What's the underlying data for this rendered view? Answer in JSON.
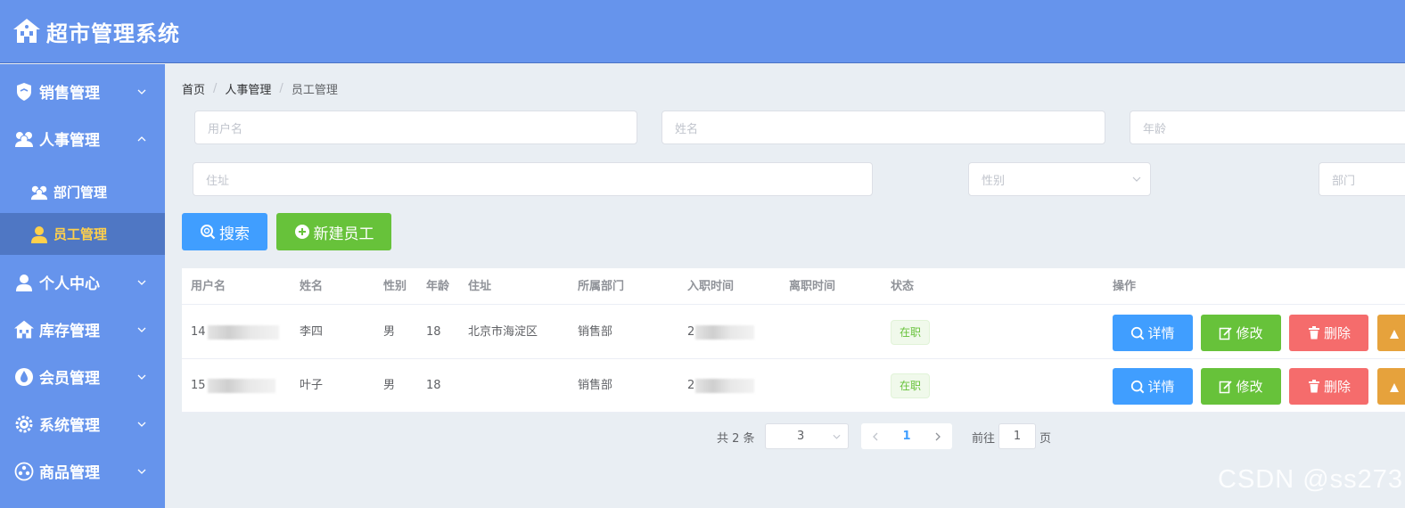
{
  "header": {
    "title": "超市管理系统"
  },
  "sidebar": {
    "items": [
      {
        "label": "销售管理"
      },
      {
        "label": "人事管理"
      },
      {
        "label": "部门管理"
      },
      {
        "label": "员工管理"
      },
      {
        "label": "个人中心"
      },
      {
        "label": "库存管理"
      },
      {
        "label": "会员管理"
      },
      {
        "label": "系统管理"
      },
      {
        "label": "商品管理"
      }
    ]
  },
  "breadcrumb": {
    "items": [
      "首页",
      "人事管理",
      "员工管理"
    ],
    "separator": "/"
  },
  "filters": {
    "username_placeholder": "用户名",
    "name_placeholder": "姓名",
    "age_placeholder": "年龄",
    "address_placeholder": "住址",
    "gender_placeholder": "性别",
    "department_placeholder": "部门"
  },
  "actions": {
    "search_label": "搜索",
    "new_label": "新建员工"
  },
  "table": {
    "columns": [
      "用户名",
      "姓名",
      "性别",
      "年龄",
      "住址",
      "所属部门",
      "入职时间",
      "离职时间",
      "状态",
      "操作"
    ],
    "rows": [
      {
        "username": "14",
        "name": "李四",
        "gender": "男",
        "age": "18",
        "address": "北京市海淀区",
        "department": "销售部",
        "hire_date": "2",
        "leave_date": "",
        "status": "在职"
      },
      {
        "username": "15",
        "name": "叶子",
        "gender": "男",
        "age": "18",
        "address": "",
        "department": "销售部",
        "hire_date": "2",
        "leave_date": "",
        "status": "在职"
      }
    ],
    "row_actions": {
      "detail": "详情",
      "edit": "修改",
      "delete": "删除"
    }
  },
  "pagination": {
    "total_text": "共 2 条",
    "page_size": "3",
    "current_page": "1",
    "goto_prefix": "前往",
    "goto_value": "1",
    "goto_suffix": "页"
  },
  "watermark": "CSDN @ss273",
  "colors": {
    "header_bg": "#6694ec",
    "primary": "#409eff",
    "success": "#67c23a",
    "danger": "#f56c6c",
    "warning": "#e6a23c",
    "active_text": "#ffd04b"
  }
}
